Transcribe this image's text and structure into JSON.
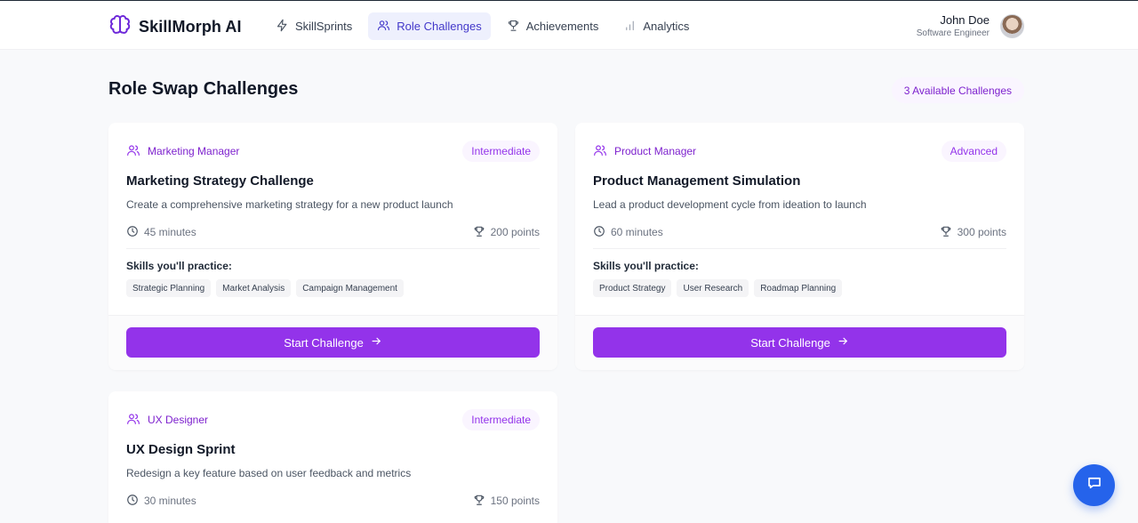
{
  "brand": {
    "name": "SkillMorph AI"
  },
  "nav": [
    {
      "label": "SkillSprints",
      "icon": "lightning-icon",
      "active": false
    },
    {
      "label": "Role Challenges",
      "icon": "users-icon",
      "active": true
    },
    {
      "label": "Achievements",
      "icon": "trophy-icon",
      "active": false
    },
    {
      "label": "Analytics",
      "icon": "bar-chart-icon",
      "active": false
    }
  ],
  "user": {
    "name": "John Doe",
    "role": "Software Engineer"
  },
  "page": {
    "title": "Role Swap Challenges",
    "count_badge": "3 Available Challenges"
  },
  "cards": [
    {
      "role": "Marketing Manager",
      "level": "Intermediate",
      "title": "Marketing Strategy Challenge",
      "description": "Create a comprehensive marketing strategy for a new product launch",
      "duration": "45 minutes",
      "points": "200 points",
      "skills_label": "Skills you'll practice:",
      "skills": [
        "Strategic Planning",
        "Market Analysis",
        "Campaign Management"
      ],
      "cta": "Start Challenge"
    },
    {
      "role": "Product Manager",
      "level": "Advanced",
      "title": "Product Management Simulation",
      "description": "Lead a product development cycle from ideation to launch",
      "duration": "60 minutes",
      "points": "300 points",
      "skills_label": "Skills you'll practice:",
      "skills": [
        "Product Strategy",
        "User Research",
        "Roadmap Planning"
      ],
      "cta": "Start Challenge"
    },
    {
      "role": "UX Designer",
      "level": "Intermediate",
      "title": "UX Design Sprint",
      "description": "Redesign a key feature based on user feedback and metrics",
      "duration": "30 minutes",
      "points": "150 points"
    }
  ],
  "colors": {
    "accent": "#9333ea",
    "nav_active_bg": "#eef0fd",
    "nav_active_text": "#4338ca",
    "chat_fab": "#2563eb"
  }
}
